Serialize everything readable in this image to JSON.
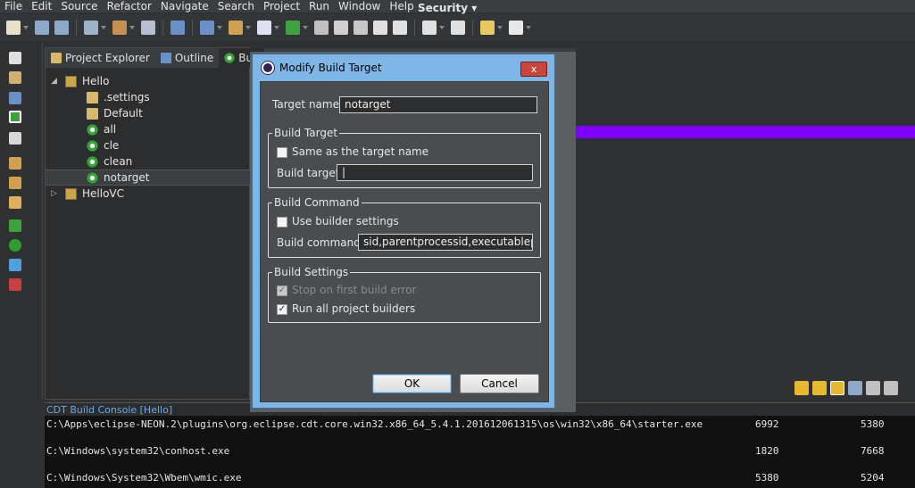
{
  "menubar": {
    "items": [
      "File",
      "Edit",
      "Source",
      "Refactor",
      "Navigate",
      "Search",
      "Project",
      "Run",
      "Window",
      "Help"
    ],
    "security_label": "Security ▾"
  },
  "explorer": {
    "tabs": [
      {
        "label": "Project Explorer",
        "icon": "project-explorer-icon"
      },
      {
        "label": "Outline",
        "icon": "outline-icon"
      },
      {
        "label": "Buil",
        "icon": "build-targets-icon"
      }
    ],
    "tree": [
      {
        "label": "Hello",
        "type": "project",
        "expanded": true
      },
      {
        "label": ".settings",
        "type": "folder"
      },
      {
        "label": "Default",
        "type": "folder"
      },
      {
        "label": "all",
        "type": "target"
      },
      {
        "label": "cle",
        "type": "target"
      },
      {
        "label": "clean",
        "type": "target"
      },
      {
        "label": "notarget",
        "type": "target",
        "selected": true
      },
      {
        "label": "HelloVC",
        "type": "project",
        "expanded": false
      }
    ]
  },
  "dialog": {
    "title": "Modify Build Target",
    "close_label": "x",
    "target_name_label": "Target name:",
    "target_name_value": "notarget",
    "build_target_group": "Build Target",
    "same_as_target_label": "Same as the target name",
    "same_as_target_checked": false,
    "build_target_label": "Build target:",
    "build_target_value": "|",
    "build_command_group": "Build Command",
    "use_builder_label": "Use builder settings",
    "use_builder_checked": false,
    "build_command_label": "Build command:",
    "build_command_value": "sid,parentprocessid,executablepath",
    "build_settings_group": "Build Settings",
    "stop_on_error_label": "Stop on first build error",
    "stop_on_error_checked": true,
    "stop_on_error_enabled": false,
    "run_all_label": "Run all project builders",
    "run_all_checked": true,
    "ok_label": "OK",
    "cancel_label": "Cancel"
  },
  "console": {
    "title": "CDT Build Console [Hello]",
    "rows": [
      {
        "path": "C:\\Apps\\eclipse-NEON.2\\plugins\\org.eclipse.cdt.core.win32.x86_64_5.4.1.201612061315\\os\\win32\\x86_64\\starter.exe",
        "pid": "6992",
        "ppid": "5380"
      },
      {
        "path": "C:\\Windows\\system32\\conhost.exe",
        "pid": "1820",
        "ppid": "7668"
      },
      {
        "path": "C:\\Windows\\System32\\Wbem\\wmic.exe",
        "pid": "5380",
        "ppid": "5204"
      }
    ]
  },
  "colors": {
    "accent_purple": "#7f00ff",
    "console_title": "#6aa8e8",
    "dialog_frame": "#7eb6e6"
  }
}
